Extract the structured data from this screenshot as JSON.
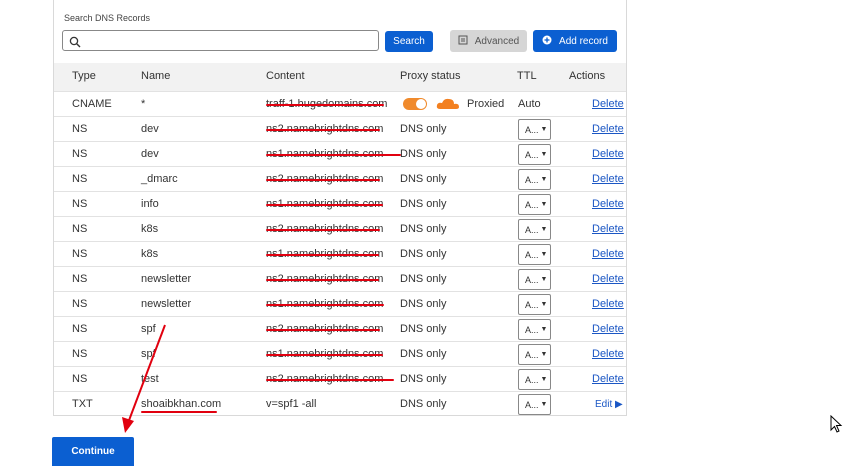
{
  "search": {
    "label": "Search DNS Records",
    "placeholder": "",
    "button": "Search"
  },
  "toolbar": {
    "advanced": "Advanced",
    "add_record": "Add record"
  },
  "table": {
    "headers": {
      "type": "Type",
      "name": "Name",
      "content": "Content",
      "proxy": "Proxy status",
      "ttl": "TTL",
      "actions": "Actions"
    },
    "rows": [
      {
        "type": "CNAME",
        "name": "*",
        "content": "traff-1.hugedomains.com",
        "proxy": "Proxied",
        "ttl": "Auto",
        "action": "Delete"
      },
      {
        "type": "NS",
        "name": "dev",
        "content": "ns2.namebrightdns.com",
        "proxy": "DNS only",
        "ttl": "A...",
        "action": "Delete"
      },
      {
        "type": "NS",
        "name": "dev",
        "content": "ns1.namebrightdns.com",
        "proxy": "DNS only",
        "ttl": "A...",
        "action": "Delete"
      },
      {
        "type": "NS",
        "name": "_dmarc",
        "content": "ns2.namebrightdns.com",
        "proxy": "DNS only",
        "ttl": "A...",
        "action": "Delete"
      },
      {
        "type": "NS",
        "name": "info",
        "content": "ns1.namebrightdns.com",
        "proxy": "DNS only",
        "ttl": "A...",
        "action": "Delete"
      },
      {
        "type": "NS",
        "name": "k8s",
        "content": "ns2.namebrightdns.com",
        "proxy": "DNS only",
        "ttl": "A...",
        "action": "Delete"
      },
      {
        "type": "NS",
        "name": "k8s",
        "content": "ns1.namebrightdns.com",
        "proxy": "DNS only",
        "ttl": "A...",
        "action": "Delete"
      },
      {
        "type": "NS",
        "name": "newsletter",
        "content": "ns2.namebrightdns.com",
        "proxy": "DNS only",
        "ttl": "A...",
        "action": "Delete"
      },
      {
        "type": "NS",
        "name": "newsletter",
        "content": "ns1.namebrightdns.com",
        "proxy": "DNS only",
        "ttl": "A...",
        "action": "Delete"
      },
      {
        "type": "NS",
        "name": "spf",
        "content": "ns2.namebrightdns.com",
        "proxy": "DNS only",
        "ttl": "A...",
        "action": "Delete"
      },
      {
        "type": "NS",
        "name": "spf",
        "content": "ns1.namebrightdns.com",
        "proxy": "DNS only",
        "ttl": "A...",
        "action": "Delete"
      },
      {
        "type": "NS",
        "name": "test",
        "content": "ns2.namebrightdns.com",
        "proxy": "DNS only",
        "ttl": "A...",
        "action": "Delete"
      },
      {
        "type": "TXT",
        "name": "shoaibkhan.com",
        "content": "v=spf1 -all",
        "proxy": "DNS only",
        "ttl": "A...",
        "action": "Edit"
      }
    ]
  },
  "footer": {
    "continue": "Continue"
  },
  "colors": {
    "primary": "#0b5fd1",
    "proxied_orange": "#f08a2c",
    "redaction": "#e1000f",
    "link": "#1a56c4"
  },
  "icons": [
    "search-icon",
    "advanced-icon",
    "add-icon",
    "cloud-icon",
    "chevron-down-icon",
    "caret-right-icon",
    "mouse-cursor-icon"
  ]
}
